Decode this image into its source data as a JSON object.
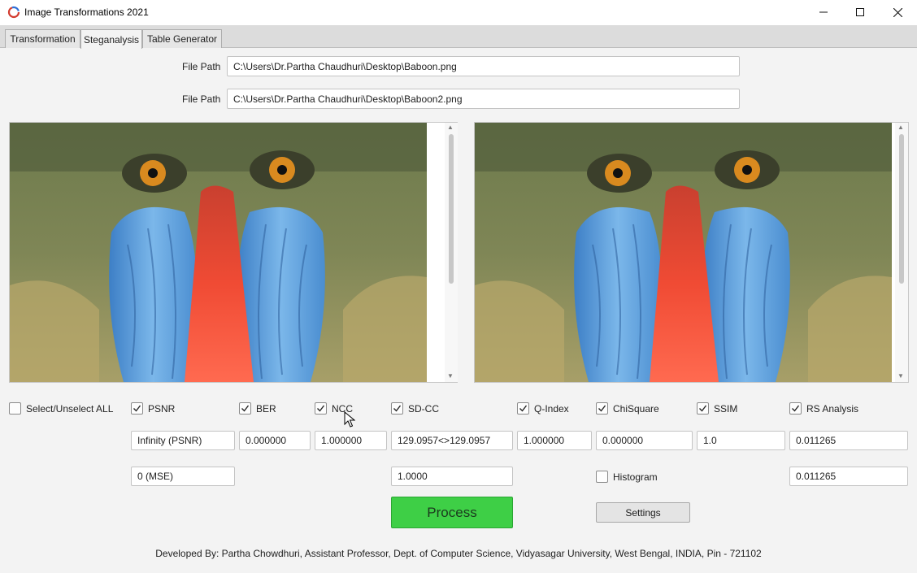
{
  "window": {
    "title": "Image Transformations 2021",
    "controls": {
      "minimize": "─",
      "maximize": "☐",
      "close": "✕"
    }
  },
  "tabs": [
    {
      "label": "Transformation",
      "active": false
    },
    {
      "label": "Steganalysis",
      "active": true
    },
    {
      "label": "Table Generator",
      "active": false
    }
  ],
  "file_paths": {
    "label": "File Path",
    "first": "C:\\Users\\Dr.Partha Chaudhuri\\Desktop\\Baboon.png",
    "second": "C:\\Users\\Dr.Partha Chaudhuri\\Desktop\\Baboon2.png"
  },
  "images": {
    "left": "baboon-image",
    "right": "baboon-image"
  },
  "checks": {
    "select_all": {
      "label": "Select/Unselect ALL",
      "checked": false
    },
    "psnr": {
      "label": "PSNR",
      "checked": true
    },
    "ber": {
      "label": "BER",
      "checked": true
    },
    "ncc": {
      "label": "NCC",
      "checked": true
    },
    "sdcc": {
      "label": "SD-CC",
      "checked": true
    },
    "qindex": {
      "label": "Q-Index",
      "checked": true
    },
    "chisquare": {
      "label": "ChiSquare",
      "checked": true
    },
    "ssim": {
      "label": "SSIM",
      "checked": true
    },
    "rs": {
      "label": "RS Analysis",
      "checked": true
    },
    "histogram": {
      "label": "Histogram",
      "checked": false
    }
  },
  "results": {
    "psnr": "Infinity (PSNR)",
    "mse": "0 (MSE)",
    "ber": "0.000000",
    "ncc": "1.000000",
    "sdcc": "129.0957<>129.0957",
    "sdcc2": "1.0000",
    "qindex": "1.000000",
    "chisquare": "0.000000",
    "ssim": "1.0",
    "rs1": "0.011265",
    "rs2": "0.011265"
  },
  "buttons": {
    "process": "Process",
    "settings": "Settings"
  },
  "colors": {
    "process_green": "#3ecf46",
    "accent_blue": "#2f6fd6"
  },
  "footer": "Developed By: Partha Chowdhuri, Assistant Professor, Dept. of Computer Science, Vidyasagar University, West Bengal, INDIA, Pin - 721102"
}
